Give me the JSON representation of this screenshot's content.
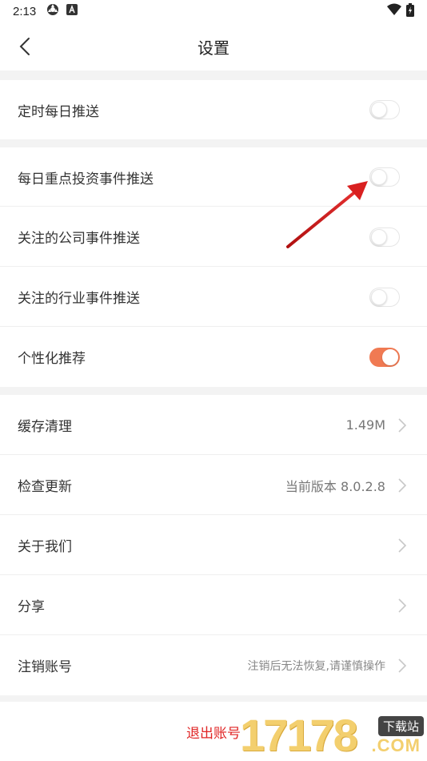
{
  "status_bar": {
    "time": "2:13"
  },
  "header": {
    "title": "设置"
  },
  "section1": {
    "items": [
      {
        "label": "定时每日推送",
        "toggle_on": false
      }
    ]
  },
  "section2": {
    "items": [
      {
        "label": "每日重点投资事件推送",
        "toggle_on": false
      },
      {
        "label": "关注的公司事件推送",
        "toggle_on": false
      },
      {
        "label": "关注的行业事件推送",
        "toggle_on": false
      },
      {
        "label": "个性化推荐",
        "toggle_on": true
      }
    ]
  },
  "section3": {
    "items": [
      {
        "label": "缓存清理",
        "value": "1.49M"
      },
      {
        "label": "检查更新",
        "value": "当前版本 8.0.2.8"
      },
      {
        "label": "关于我们",
        "value": ""
      },
      {
        "label": "分享",
        "value": ""
      },
      {
        "label": "注销账号",
        "value": "注销后无法恢复,请谨慎操作"
      }
    ]
  },
  "footer": {
    "logout_label": "退出账号"
  },
  "watermark": {
    "digits": "17178",
    "badge": "下载站",
    "domain": ".COM"
  },
  "colors": {
    "accent": "#f07a53",
    "logout": "#e02525",
    "arrow": "#d92020"
  }
}
